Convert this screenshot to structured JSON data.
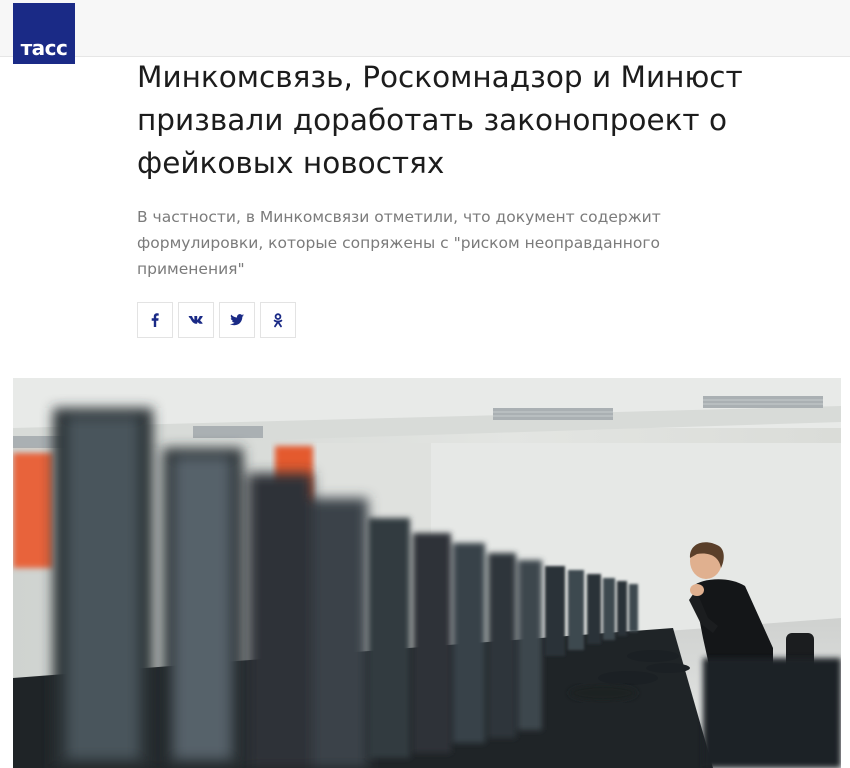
{
  "header": {
    "logo_text": "тасс"
  },
  "article": {
    "headline": "Минкомсвязь, Роскомнадзор и Минюст призвали доработать законопроект о фейковых новостях",
    "lead": "В частности, в Минкомсвязи отметили, что документ содержит формулировки, которые сопряжены с \"риском неоправданного применения\""
  },
  "share": [
    {
      "network": "facebook",
      "icon": "facebook-icon"
    },
    {
      "network": "vk",
      "icon": "vk-icon"
    },
    {
      "network": "twitter",
      "icon": "twitter-icon"
    },
    {
      "network": "odnoklassniki",
      "icon": "odnoklassniki-icon"
    }
  ],
  "colors": {
    "brand": "#1a2a86",
    "share_icon": "#1a2a86",
    "lead_text": "#7b7b7b"
  },
  "photo": {
    "description_icon": "photo"
  }
}
